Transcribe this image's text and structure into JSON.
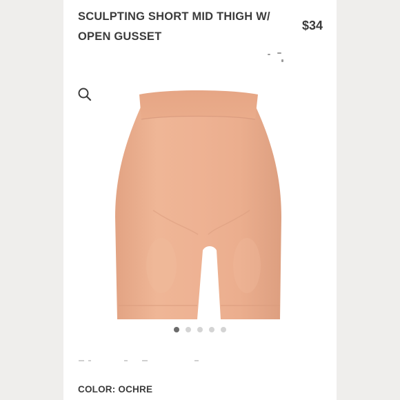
{
  "product": {
    "title": "SCULPTING SHORT MID THIGH W/ OPEN GUSSET",
    "price": "$34",
    "color_label": "COLOR: OCHRE"
  },
  "icons": {
    "search": "search-icon"
  },
  "image_carousel": {
    "total_slides": 5,
    "active_slide": 1
  },
  "colors": {
    "text": "#3b3b3b",
    "product_fill": "#e8a888",
    "dot_active": "#6b6b6b",
    "dot_inactive": "#d4d4d4"
  }
}
